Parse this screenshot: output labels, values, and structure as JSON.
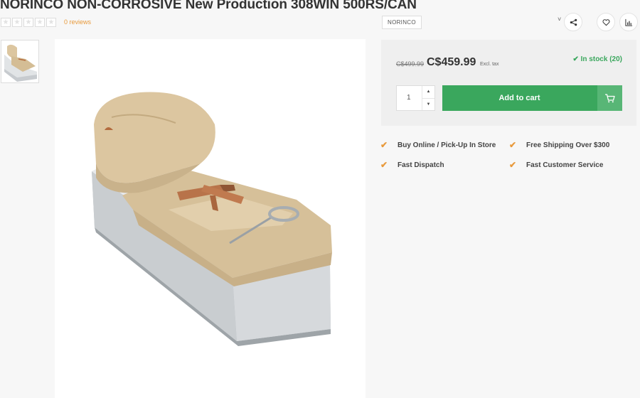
{
  "product": {
    "title": "NORINCO NON-CORROSIVE New Production 308WIN 500RS/CAN",
    "reviews_label": "0 reviews",
    "rating_stars": 0,
    "brand": "NORINCO"
  },
  "actions": {
    "chevron": "˅",
    "share_icon": "share-icon",
    "wishlist_icon": "heart-icon",
    "compare_icon": "bar-chart-icon"
  },
  "pricing": {
    "old_price": "C$499.99",
    "price": "C$459.99",
    "tax_note": "Excl. tax",
    "stock": "In stock (20)"
  },
  "cart": {
    "quantity": "1",
    "add_label": "Add to cart"
  },
  "usps": [
    "Buy Online / Pick-Up In Store",
    "Free Shipping Over $300",
    "Fast Dispatch",
    "Fast Customer Service"
  ],
  "colors": {
    "accent_green": "#3aa75d",
    "accent_orange": "#e89a3c"
  }
}
